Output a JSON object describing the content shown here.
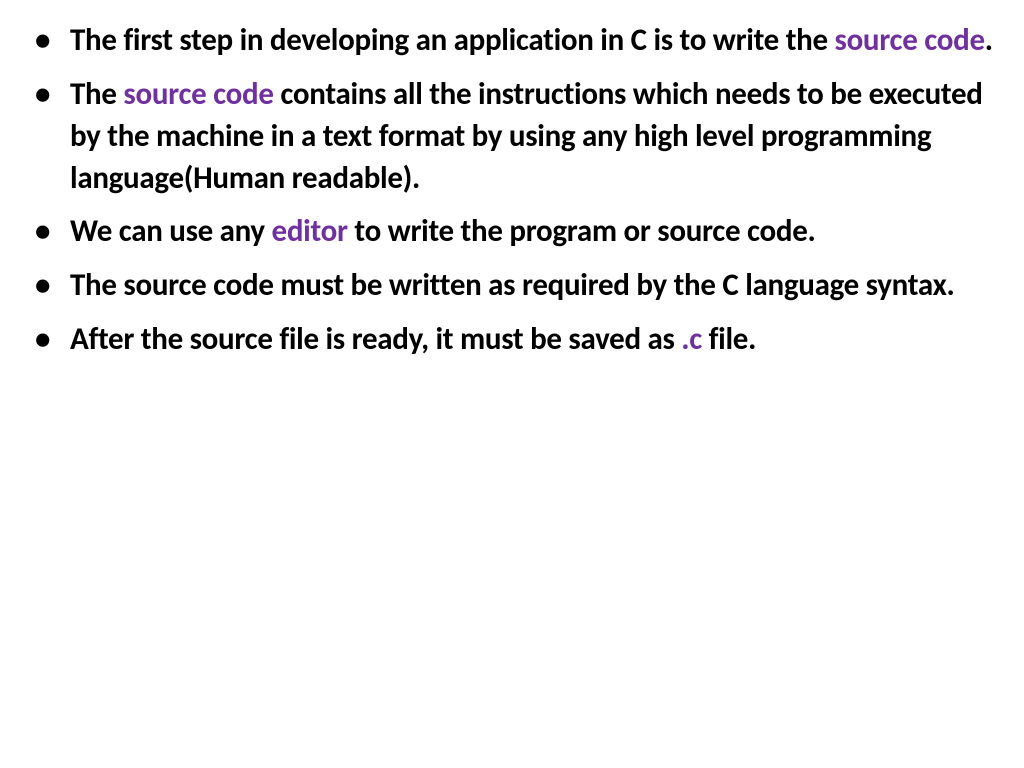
{
  "accent_color": "#7030a0",
  "bullets": [
    {
      "parts": [
        {
          "text": "The first step in developing an application in C is to write the ",
          "hl": false
        },
        {
          "text": "source code",
          "hl": true
        },
        {
          "text": ".",
          "hl": false
        }
      ]
    },
    {
      "parts": [
        {
          "text": "The ",
          "hl": false
        },
        {
          "text": "source code",
          "hl": true
        },
        {
          "text": " contains all the instructions which needs to be executed by the machine in a text format by using any high level programming language(Human readable).",
          "hl": false
        }
      ]
    },
    {
      "parts": [
        {
          "text": "We can use any ",
          "hl": false
        },
        {
          "text": "editor",
          "hl": true
        },
        {
          "text": " to write the program or source code.",
          "hl": false
        }
      ]
    },
    {
      "parts": [
        {
          "text": "The source code must be written as required by the C language syntax.",
          "hl": false
        }
      ]
    },
    {
      "parts": [
        {
          "text": "After the source file is ready, it must be saved as ",
          "hl": false
        },
        {
          "text": ".c",
          "hl": true
        },
        {
          "text": " file.",
          "hl": false
        }
      ]
    }
  ]
}
